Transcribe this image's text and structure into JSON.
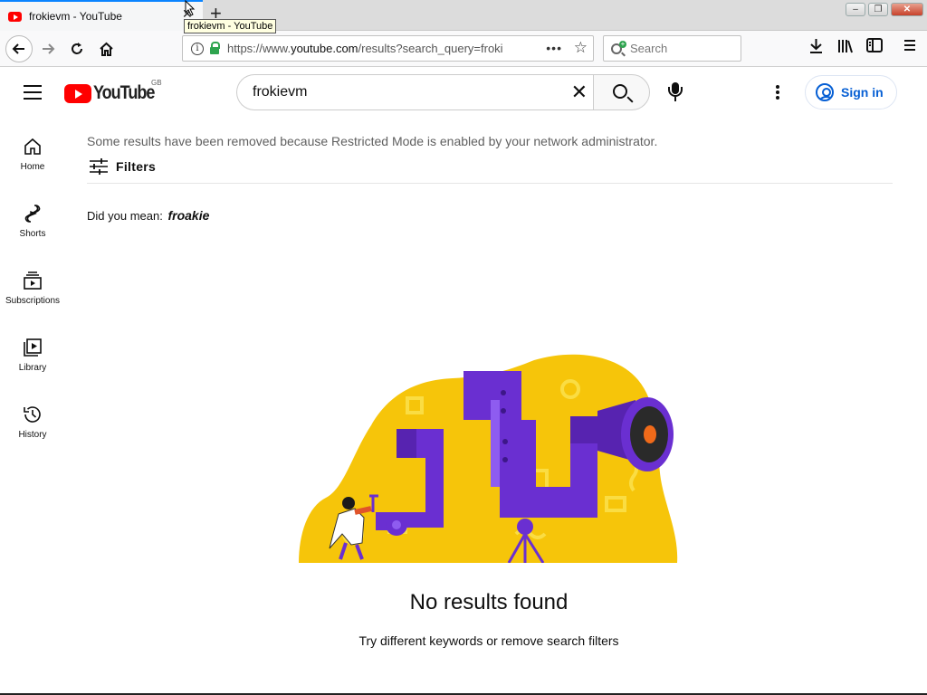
{
  "browser": {
    "tab_title": "frokievm - YouTube",
    "tooltip": "frokievm - YouTube",
    "url_prefix": "https://www.",
    "url_domain": "youtube.com",
    "url_rest": "/results?search_query=froki",
    "search_placeholder": "Search",
    "icons": {
      "back": "back-arrow-icon",
      "forward": "forward-arrow-icon",
      "reload": "reload-icon",
      "home": "home-icon",
      "downloads": "download-icon",
      "library": "library-icon",
      "sidebar": "sidebar-icon",
      "menu": "hamburger-menu-icon"
    }
  },
  "youtube": {
    "logo_text": "YouTube",
    "country_code": "GB",
    "search_value": "frokievm",
    "sign_in_label": "Sign in",
    "accent_color": "#065fd4",
    "brand_color": "#ff0000"
  },
  "guide": {
    "items": [
      {
        "label": "Home",
        "icon": "home-icon"
      },
      {
        "label": "Shorts",
        "icon": "shorts-icon"
      },
      {
        "label": "Subscriptions",
        "icon": "subscriptions-icon"
      },
      {
        "label": "Library",
        "icon": "library-icon"
      },
      {
        "label": "History",
        "icon": "history-icon"
      }
    ]
  },
  "results": {
    "restricted_notice": "Some results have been removed because Restricted Mode is enabled by your network administrator.",
    "filters_label": "Filters",
    "did_you_mean_label": "Did you mean:",
    "suggestion": "froakie",
    "no_results_title": "No results found",
    "no_results_subtitle": "Try different keywords or remove search filters"
  }
}
